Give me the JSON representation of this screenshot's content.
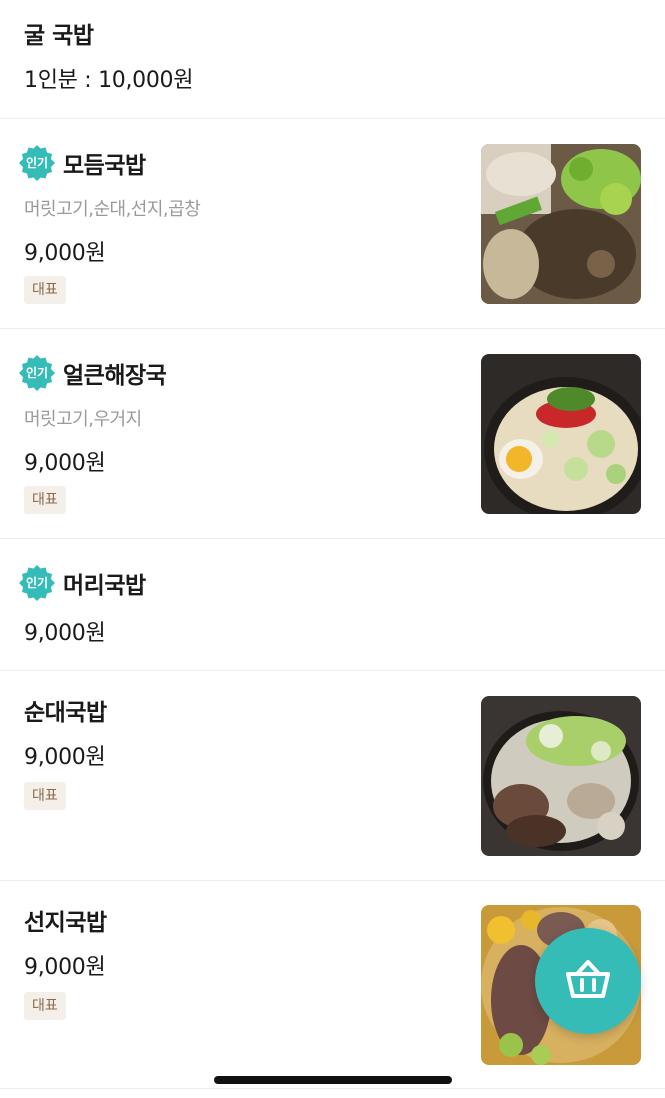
{
  "top_item": {
    "name": "굴 국밥",
    "price": "1인분 : 10,000원"
  },
  "popular_badge": "인기",
  "items": [
    {
      "name": "모듬국밥",
      "desc": "머릿고기,순대,선지,곱창",
      "price": "9,000원",
      "tag": "대표",
      "popular": true,
      "image": "soup-with-head-meat-photo"
    },
    {
      "name": "얼큰해장국",
      "desc": "머릿고기,우거지",
      "price": "9,000원",
      "tag": "대표",
      "popular": true,
      "image": "spicy-haejangguk-photo"
    },
    {
      "name": "머리국밥",
      "price": "9,000원",
      "popular": true
    },
    {
      "name": "순대국밥",
      "price": "9,000원",
      "tag": "대표",
      "popular": false,
      "image": "sundae-gukbap-photo"
    },
    {
      "name": "선지국밥",
      "price": "9,000원",
      "tag": "대표",
      "popular": false,
      "image": "seonji-gukbap-photo"
    }
  ],
  "cart": {
    "icon": "basket-icon"
  },
  "colors": {
    "accent": "#35bcb6",
    "tag_bg": "#f4efe8",
    "tag_text": "#8a6a4b"
  }
}
